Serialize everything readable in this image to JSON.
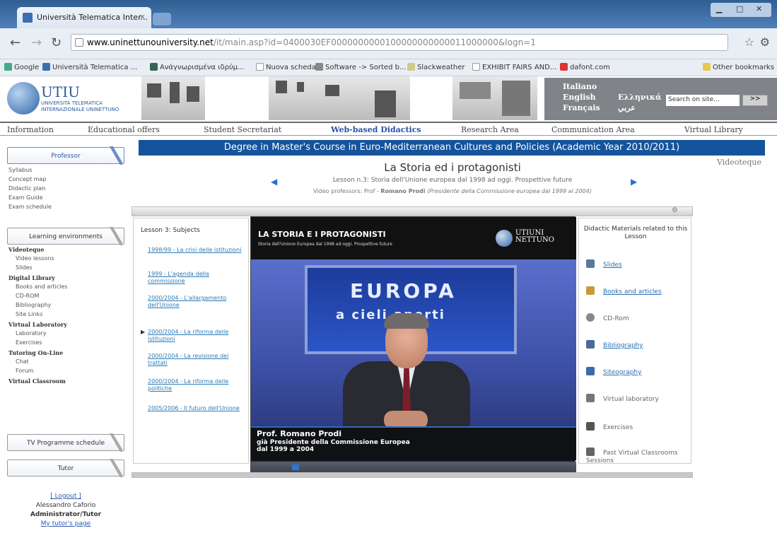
{
  "browser": {
    "tab_title": "Università Telematica Inter...",
    "tab_close": "×",
    "url_host": "www.uninettunouniversity.net",
    "url_path": "/it/main.asp?id=0400030EF0000000000100000000000011000000&logn=1",
    "bookmarks": [
      "Google",
      "Università Telematica ...",
      "Ανάγνωρισμένα ιδρύμ...",
      "Nuova scheda",
      "Software -> Sorted b...",
      "Slackweather",
      "EXHIBIT FAIRS AND...",
      "dafont.com",
      "Other bookmarks"
    ]
  },
  "site": {
    "logo_title": "UTIU",
    "logo_sub_1": "UNIVERSITÀ TELEMATICA",
    "logo_sub_2": "INTERNAZIONALE UNINETTUNO",
    "languages": [
      "Italiano",
      "English",
      "Français",
      "Ελληνικά",
      "عربي"
    ],
    "search_placeholder": "Search on site...",
    "search_go": ">>",
    "nav": [
      "Information",
      "Educational offers",
      "Student Secretariat",
      "Web-based Didactics",
      "Research Area",
      "Communication Area",
      "Virtual Library"
    ]
  },
  "sidebar": {
    "box_professor": "Professor",
    "items_top": [
      "Syllabus",
      "Concept map",
      "Didactic plan",
      "Exam Guide",
      "Exam schedule"
    ],
    "box_learning": "Learning environments",
    "h_videoteque": "Videoteque",
    "videoteque_items": [
      "Video lessons",
      "Slides"
    ],
    "h_digital": "Digital Library",
    "digital_items": [
      "Books and articles",
      "CD-ROM",
      "Bibliography",
      "Site Links"
    ],
    "h_virtual_lab": "Virtual Laboratory",
    "lab_items": [
      "Laboratory",
      "Exercises"
    ],
    "h_tutoring": "Tutoring On-Line",
    "tutoring_items": [
      "Chat",
      "Forum"
    ],
    "h_classroom": "Virtual Classroom",
    "box_tv": "TV Programme schedule",
    "box_tutor": "Tutor",
    "logout": "[ Logout ]",
    "user_name": "Alessandro Caforio",
    "user_role": "Administrator/Tutor",
    "tutor_page": "My tutor's page"
  },
  "main": {
    "course_title": "Degree in Master's Course in Euro-Mediterranean Cultures and Policies (Academic Year 2010/2011)",
    "videoteque": "Videoteque",
    "lesson_title": "La Storia ed i protagonisti",
    "lesson_label": "Lesson n.3:",
    "lesson_text": "Storia dell'Unione europea dal 1998 ad oggi. Prospettive future",
    "prof_prefix": "Video professors: Prof - ",
    "prof_name": "Romano Prodi",
    "prof_role": " (Presidente della Commissione europea dal 1999 al 2004)",
    "subjects_heading": "Lesson 3: Subjects",
    "subjects": [
      "1998/99 - La crisi delle istituzioni",
      "1999 - L'agenda della commissione",
      "2000/2004 - L'allargamento dell'Unione",
      "2000/2004 - La riforma delle istituzioni",
      "2000/2004 - La revisione dei trattati",
      "2000/2004 - La riforma delle politiche",
      "2005/2006 - Il futuro dell'Unione"
    ],
    "current_marker": "▶",
    "video_title": "LA STORIA E I PROTAGONISTI",
    "video_subtitle": "Storia dell'Unione Europea dal 1998 ad oggi. Prospettive future",
    "video_logo": "UTIUNI NETTUNO",
    "screen_big": "EUROPA",
    "screen_small": "a cieli aperti",
    "caption_name": "Prof. Romano Prodi",
    "caption_role_1": "già Presidente della Commissione Europea",
    "caption_role_2": "dal 1999 a 2004",
    "materials_heading": "Didactic Materials related to this Lesson",
    "materials": [
      {
        "label": "Slides",
        "link": true,
        "color": "#5a7a9a"
      },
      {
        "label": "Books and articles",
        "link": true,
        "color": "#c89a3a"
      },
      {
        "label": "CD-Rom",
        "link": false,
        "color": "#888888"
      },
      {
        "label": "Bibliography",
        "link": true,
        "color": "#4a6a9a"
      },
      {
        "label": "Siteography",
        "link": true,
        "color": "#3a6aa8"
      },
      {
        "label": "Virtual laboratory",
        "link": false,
        "color": "#777777"
      },
      {
        "label": "Exercises",
        "link": false,
        "color": "#555555"
      },
      {
        "label": "Past Virtual Classrooms Sessions",
        "link": false,
        "color": "#666666"
      }
    ]
  },
  "colors": {
    "title_bar": "#15549c",
    "link": "#2a6fb5",
    "accent": "#2a4fa3"
  }
}
